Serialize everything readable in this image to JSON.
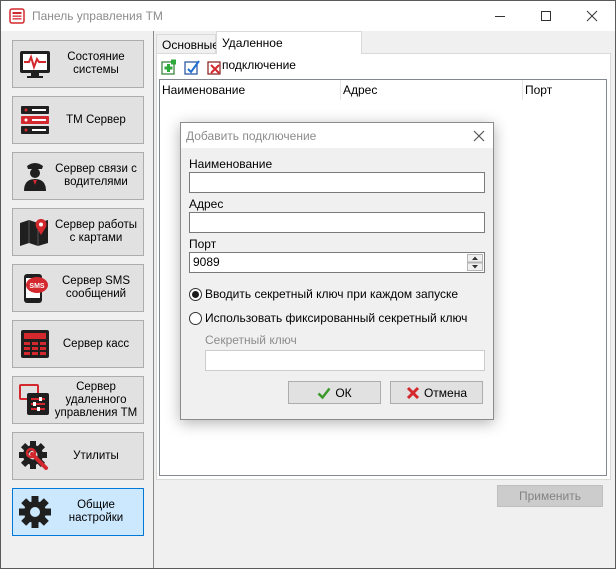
{
  "window": {
    "title": "Панель управления ТМ"
  },
  "sidebar": {
    "items": [
      {
        "label": "Состояние системы",
        "icon": "monitor-pulse-icon",
        "active": false
      },
      {
        "label": "ТМ Сервер",
        "icon": "server-rack-icon",
        "active": false
      },
      {
        "label": "Сервер связи с водителями",
        "icon": "driver-icon",
        "active": false
      },
      {
        "label": "Сервер работы с картами",
        "icon": "map-pin-icon",
        "active": false
      },
      {
        "label": "Сервер SMS сообщений",
        "icon": "sms-icon",
        "active": false
      },
      {
        "label": "Сервер касс",
        "icon": "cash-register-icon",
        "active": false
      },
      {
        "label": "Сервер удаленного управления ТМ",
        "icon": "remote-control-icon",
        "active": false
      },
      {
        "label": "Утилиты",
        "icon": "gear-wrench-icon",
        "active": false
      },
      {
        "label": "Общие настройки",
        "icon": "gear-icon",
        "active": true
      }
    ]
  },
  "tabs": [
    {
      "label": "Основные",
      "active": false
    },
    {
      "label": "Удаленное подключение",
      "active": true
    }
  ],
  "toolbar": {
    "add_icon": "add-icon",
    "edit_icon": "edit-icon",
    "delete_icon": "delete-icon"
  },
  "table": {
    "columns": [
      "Наименование",
      "Адрес",
      "Порт"
    ],
    "rows": []
  },
  "apply_label": "Применить",
  "dialog": {
    "title": "Добавить подключение",
    "name_label": "Наименование",
    "name_value": "",
    "address_label": "Адрес",
    "address_value": "",
    "port_label": "Порт",
    "port_value": "9089",
    "radio_prompt_label": "Вводить секретный ключ при каждом запуске",
    "radio_prompt_selected": true,
    "radio_fixed_label": "Использовать фиксированный секретный ключ",
    "radio_fixed_selected": false,
    "secret_key_label": "Секретный ключ",
    "secret_key_value": "",
    "ok_label": "ОК",
    "cancel_label": "Отмена"
  },
  "colors": {
    "active_nav_bg": "#cce8ff",
    "active_nav_border": "#0078d7",
    "brand_red": "#d3282d",
    "disabled_text": "#8c8c8c"
  }
}
